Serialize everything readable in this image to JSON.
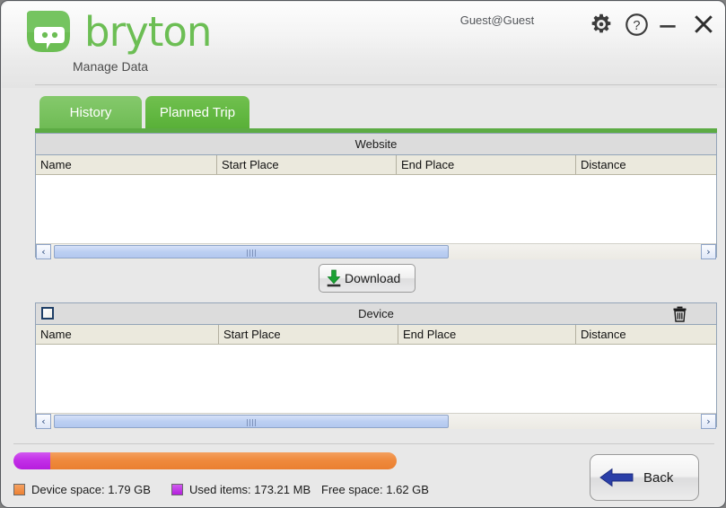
{
  "window": {
    "brand": "bryton",
    "subtitle": "Manage Data",
    "user": "Guest@Guest",
    "controls": {
      "settings": "settings-gear",
      "help": "help-question",
      "minimize": "minimize-dash",
      "close": "close-x"
    }
  },
  "tabs": [
    {
      "label": "History",
      "active": false
    },
    {
      "label": "Planned Trip",
      "active": true
    }
  ],
  "website_table": {
    "caption": "Website",
    "columns": [
      "Name",
      "Start Place",
      "End Place",
      "Distance"
    ],
    "rows": [],
    "scrollbar": {
      "left_arrow": "‹",
      "right_arrow": "›"
    }
  },
  "download": {
    "label": "Download",
    "icon": "download-arrow-icon"
  },
  "device_table": {
    "caption": "Device",
    "select_all_checked": false,
    "delete_icon": "trash-icon",
    "columns": [
      "Name",
      "Start Place",
      "End Place",
      "Distance"
    ],
    "rows": [],
    "scrollbar": {
      "left_arrow": "‹",
      "right_arrow": "›"
    }
  },
  "storage": {
    "device_space_label": "Device space: 1.79 GB",
    "used_items_label": "Used items: 173.21 MB",
    "free_space_label": "Free space: 1.62 GB",
    "used_percent": 9.5,
    "colors": {
      "used": "#b41fdd",
      "free": "#ec8132"
    }
  },
  "footer": {
    "back_label": "Back",
    "back_icon": "back-arrow-icon"
  }
}
